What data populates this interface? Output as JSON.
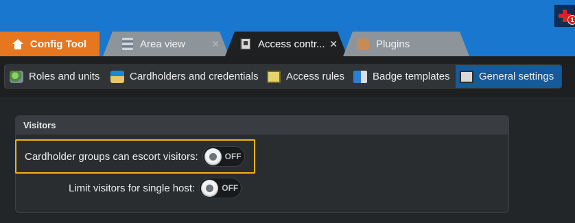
{
  "header": {
    "notification_count": "1"
  },
  "tabs": [
    {
      "label": "Config Tool",
      "icon": "home-icon"
    },
    {
      "label": "Area view",
      "icon": "area-view-icon"
    },
    {
      "label": "Access contr...",
      "icon": "access-control-icon"
    },
    {
      "label": "Plugins",
      "icon": "plugins-icon"
    }
  ],
  "subnav": [
    {
      "label": "Roles and units",
      "icon": "roles-units-icon"
    },
    {
      "label": "Cardholders and credentials",
      "icon": "cardholders-icon"
    },
    {
      "label": "Access rules",
      "icon": "access-rules-icon"
    },
    {
      "label": "Badge templates",
      "icon": "badge-templates-icon"
    },
    {
      "label": "General settings",
      "icon": "general-settings-icon"
    }
  ],
  "panel": {
    "title": "Visitors",
    "settings": [
      {
        "label": "Cardholder groups can escort visitors:",
        "state": "OFF"
      },
      {
        "label": "Limit visitors for single host:",
        "state": "OFF"
      }
    ]
  },
  "colors": {
    "title_bar": "#1977cf",
    "config_tab": "#e6771e",
    "active_subnav": "#155a99",
    "highlight_border": "#f0b417"
  }
}
